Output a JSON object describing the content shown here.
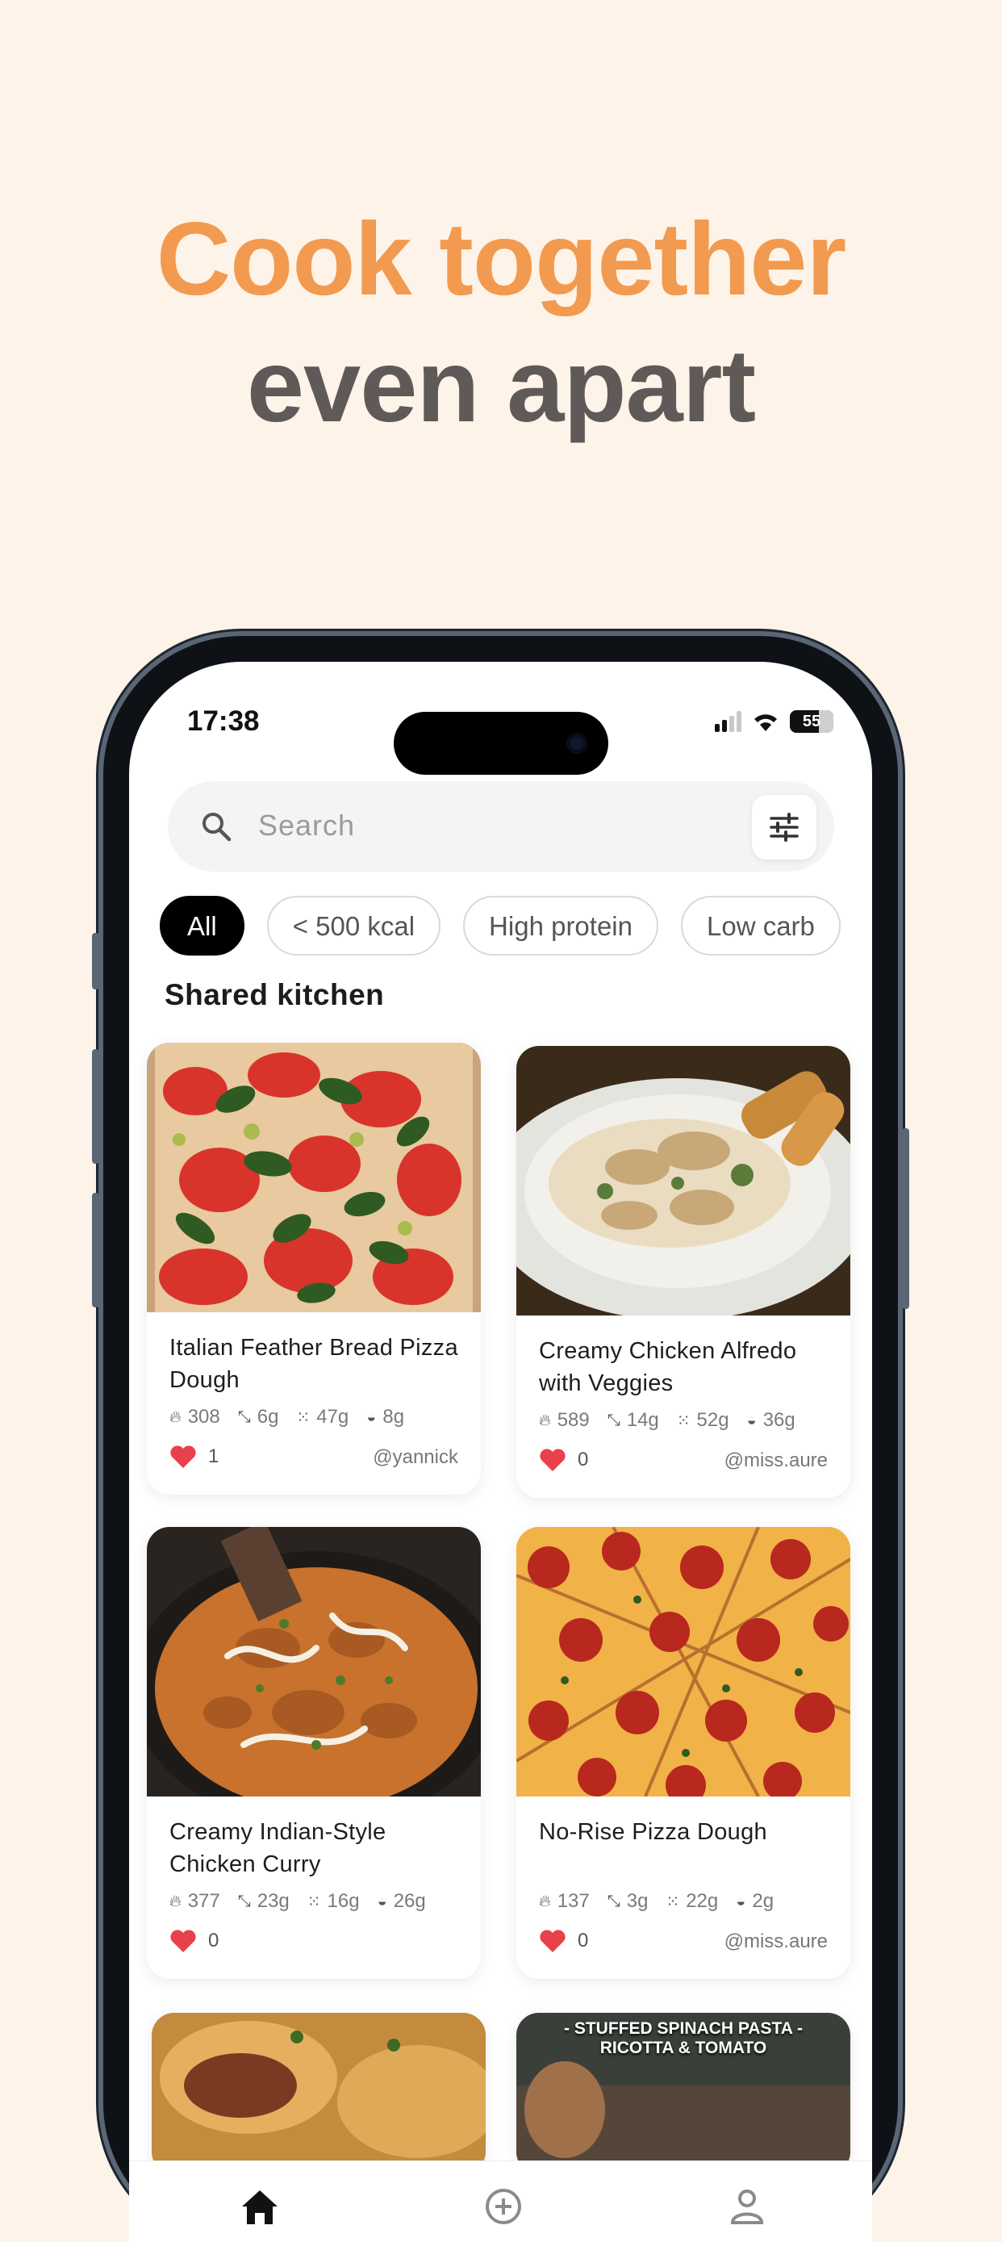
{
  "headline": {
    "line1": "Cook together",
    "line2": "even apart"
  },
  "status_bar": {
    "time": "17:38",
    "battery": "55"
  },
  "search": {
    "placeholder": "Search"
  },
  "filters": [
    "All",
    "< 500 kcal",
    "High protein",
    "Low carb"
  ],
  "section_title": "Shared kitchen",
  "recipes": [
    {
      "title": "Italian Feather Bread Pizza Dough",
      "kcal": "308",
      "protein": "6g",
      "carbs": "47g",
      "fat": "8g",
      "likes": "1",
      "author": "@yannick"
    },
    {
      "title": "Creamy Chicken Alfredo with Veggies",
      "kcal": "589",
      "protein": "14g",
      "carbs": "52g",
      "fat": "36g",
      "likes": "0",
      "author": "@miss.aure"
    },
    {
      "title": "Creamy Indian-Style Chicken Curry",
      "kcal": "377",
      "protein": "23g",
      "carbs": "16g",
      "fat": "26g",
      "likes": "0",
      "author": ""
    },
    {
      "title": "No-Rise Pizza Dough",
      "kcal": "137",
      "protein": "3g",
      "carbs": "22g",
      "fat": "2g",
      "likes": "0",
      "author": "@miss.aure"
    }
  ],
  "partial_card_overlay": "- STUFFED SPINACH PASTA -\nRICOTTA & TOMATO",
  "tabs": [
    "home-icon",
    "add-circle-icon",
    "profile-icon"
  ],
  "colors": {
    "accent": "#f29a4f",
    "background": "#fdf3e8",
    "heart": "#e8414b"
  }
}
